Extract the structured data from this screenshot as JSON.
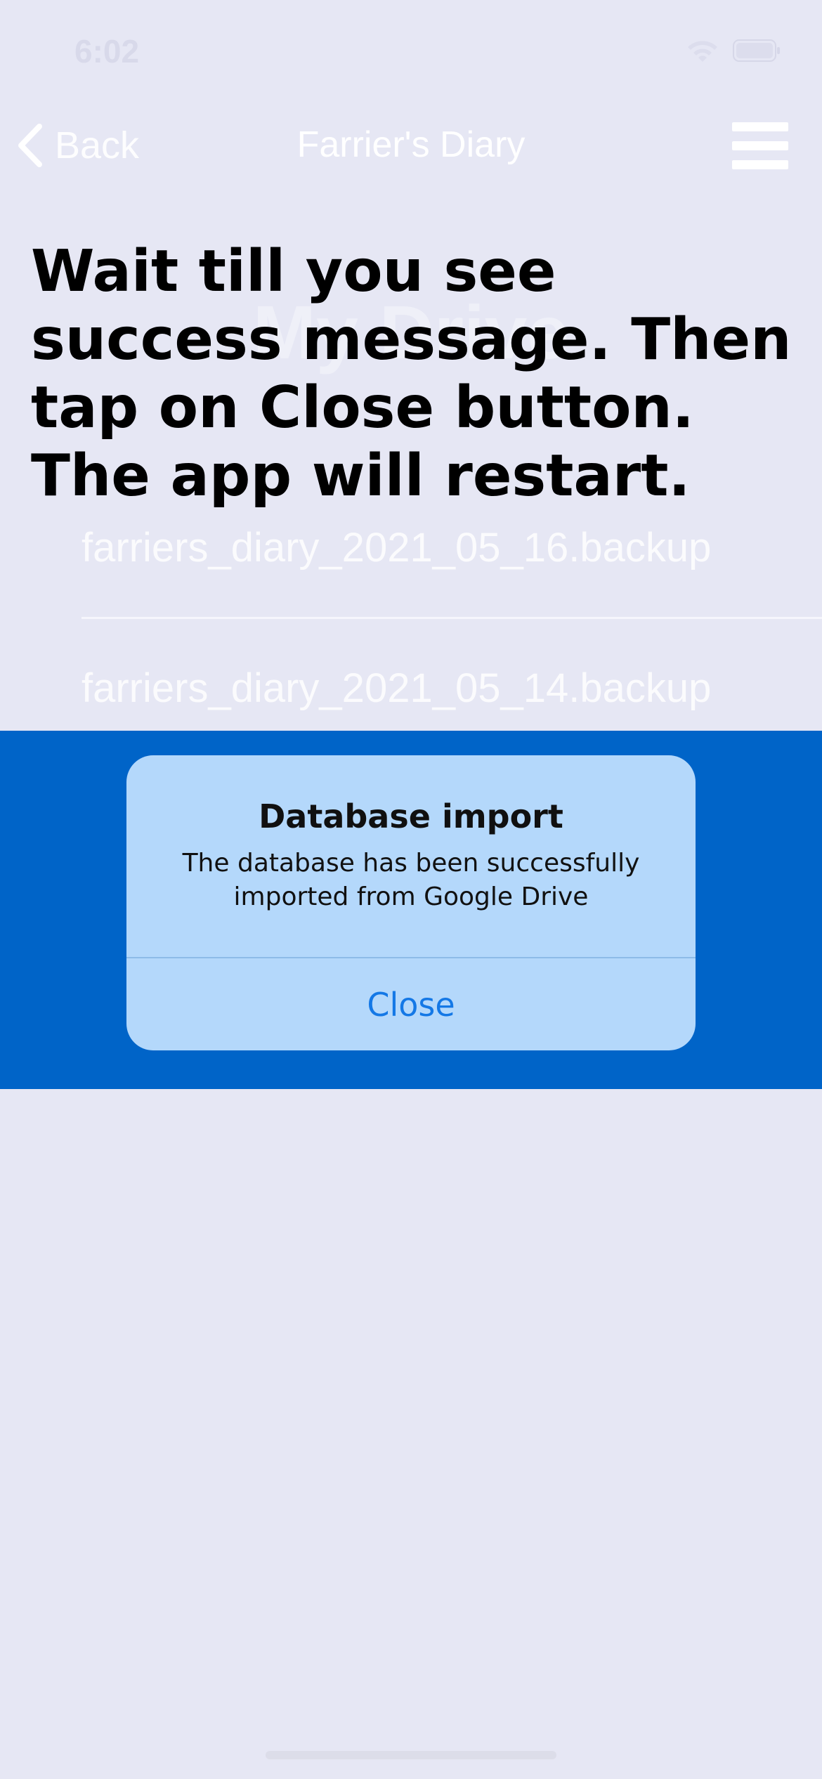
{
  "status_bar": {
    "time": "6:02"
  },
  "nav": {
    "back_label": "Back",
    "title": "Farrier's Diary"
  },
  "drive": {
    "title": "My Drive",
    "files": [
      {
        "name": "farriers_diary_2021_05_16.backup"
      },
      {
        "name": "farriers_diary_2021_05_14.backup"
      }
    ]
  },
  "instruction": "Wait till you see success message. Then tap on Close button. The app will restart.",
  "alert": {
    "title": "Database import",
    "message": "The database has been successfully imported from Google Drive",
    "close_label": "Close"
  },
  "icons": {
    "back": "chevron-left-icon",
    "menu": "hamburger-menu-icon",
    "wifi": "wifi-icon",
    "battery": "battery-icon"
  },
  "colors": {
    "background": "#e6e7f4",
    "band": "#0064c8",
    "alert_background": "#b4d8fb",
    "alert_button": "#1478e6"
  }
}
